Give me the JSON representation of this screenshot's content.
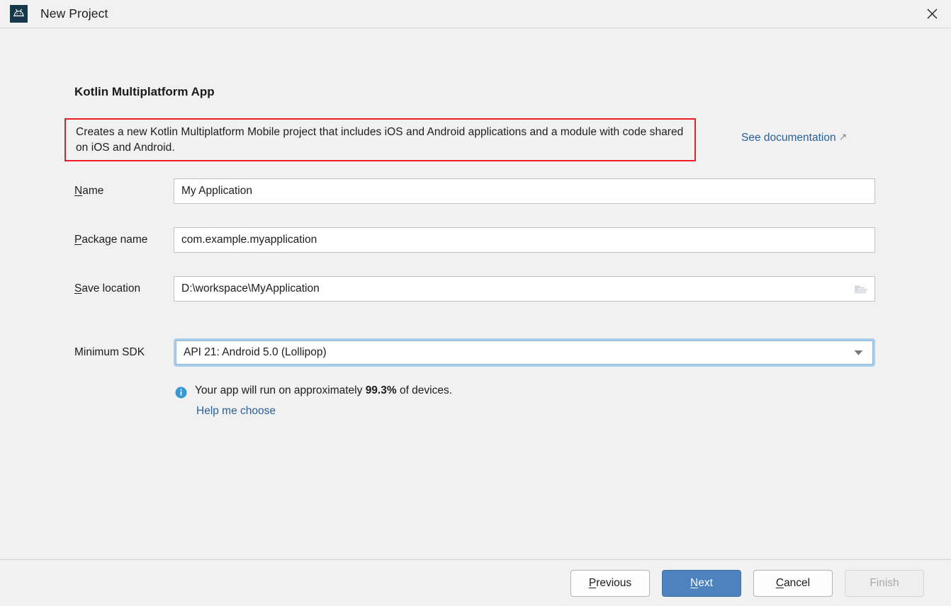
{
  "window": {
    "title": "New Project",
    "app_icon": "android-robot-icon",
    "close_label": "×"
  },
  "main": {
    "section_title": "Kotlin Multiplatform App",
    "description": "Creates a new Kotlin Multiplatform Mobile project that includes iOS and Android applications and a module with code shared on iOS and Android.",
    "description_highlight_color": "#ee1c25",
    "doc_link": "See documentation",
    "doc_link_icon": "external-link-arrow-icon",
    "link_color": "#2a6099"
  },
  "form": {
    "name": {
      "label_pre": "",
      "label_mnemonic": "N",
      "label_post": "ame",
      "value": "My Application"
    },
    "package_name": {
      "label_pre": "",
      "label_mnemonic": "P",
      "label_post": "ackage name",
      "value": "com.example.myapplication"
    },
    "save_location": {
      "label_pre": "",
      "label_mnemonic": "S",
      "label_post": "ave location",
      "value": "D:\\workspace\\MyApplication",
      "browse_icon": "folder-icon"
    },
    "minimum_sdk": {
      "label": "Minimum SDK",
      "value": "API 21: Android 5.0 (Lollipop)",
      "dropdown_icon": "chevron-down-icon",
      "focus_ring_color": "#a7cdf0"
    }
  },
  "info": {
    "icon": "info-icon",
    "text_before": "Your app will run on approximately ",
    "percent": "99.3%",
    "text_after": " of devices.",
    "help_link": "Help me choose"
  },
  "footer": {
    "buttons": [
      {
        "mnemonic": "P",
        "rest": "revious",
        "state": "default"
      },
      {
        "mnemonic": "N",
        "rest": "ext",
        "state": "primary"
      },
      {
        "mnemonic": "C",
        "rest": "ancel",
        "state": "default"
      },
      {
        "mnemonic": "",
        "rest": "Finish",
        "state": "disabled"
      }
    ],
    "primary_color": "#4c82bd"
  }
}
